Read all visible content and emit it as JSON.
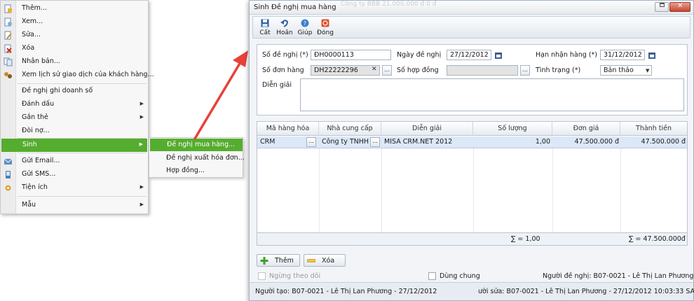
{
  "context_menu": {
    "items": [
      {
        "label": "Thêm...",
        "icon": "add-doc-icon"
      },
      {
        "label": "Xem...",
        "icon": "view-doc-icon"
      },
      {
        "label": "Sửa...",
        "icon": "edit-doc-icon"
      },
      {
        "label": "Xóa",
        "icon": "delete-doc-icon"
      },
      {
        "label": "Nhân bản...",
        "icon": "duplicate-icon"
      },
      {
        "label": "Xem lịch sử giao dịch của khách hàng...",
        "icon": "history-icon"
      },
      {
        "label": "Đề nghị ghi doanh số"
      },
      {
        "label": "Đánh dấu"
      },
      {
        "label": "Gắn thẻ"
      },
      {
        "label": "Đòi nợ..."
      },
      {
        "label": "Sinh"
      },
      {
        "label": "Gửi Email...",
        "icon": "email-icon"
      },
      {
        "label": "Gửi SMS...",
        "icon": "sms-icon"
      },
      {
        "label": "Tiện ích",
        "icon": "utility-icon"
      },
      {
        "label": "Mẫu"
      }
    ],
    "submenu": [
      {
        "label": "Đề nghị mua hàng..."
      },
      {
        "label": "Đề nghị xuất hóa đơn..."
      },
      {
        "label": "Hợp đồng..."
      }
    ],
    "accent": "#55ad2f"
  },
  "dialog": {
    "title": "Sinh Đề nghị mua hàng",
    "ghost_text": "Công ty BBB                              21.000.000 đ                    0 đ",
    "toolbar": {
      "save": "Cất",
      "undo": "Hoãn",
      "help": "Giúp",
      "close": "Đóng"
    },
    "form": {
      "so_de_nghi_label": "Số đề nghị (*)",
      "so_de_nghi_value": "ĐH0000113",
      "ngay_de_nghi_label": "Ngày đề nghị",
      "ngay_de_nghi_value": "27/12/2012",
      "han_nhan_hang_label": "Hạn nhận hàng (*)",
      "han_nhan_hang_value": "31/12/2012",
      "so_don_hang_label": "Số đơn hàng",
      "so_don_hang_value": "DH22222296",
      "so_hop_dong_label": "Số hợp đồng",
      "tinh_trang_label": "Tình trạng (*)",
      "tinh_trang_value": "Bản thảo",
      "dien_giai_label": "Diễn giải"
    },
    "grid": {
      "headers": [
        "Mã hàng hóa",
        "Nhà cung cấp",
        "Diễn giải",
        "Số lượng",
        "Đơn giá",
        "Thành tiền"
      ],
      "rows": [
        {
          "ma_hang": "CRM",
          "nha_cung_cap": "Công ty TNHH",
          "dien_giai": "MISA CRM.NET 2012",
          "so_luong": "1,00",
          "don_gia": "47.500.000 đ",
          "thanh_tien": "47.500.000 đ"
        }
      ],
      "sum_qty": "∑ =  1,00",
      "sum_total": "∑ =  47.500.000đ"
    },
    "buttons": {
      "add": "Thêm",
      "delete": "Xóa"
    },
    "footer": {
      "stop_tracking": "Ngừng theo dõi",
      "shared": "Dùng chung",
      "requester": "Người đề nghị:  B07-0021 - Lê Thị Lan Phương",
      "created_by": "Người tạo: B07-0021 - Lê Thị Lan Phương - 27/12/2012",
      "modified_by": "ười sửa: B07-0021 - Lê Thị Lan Phương - 27/12/2012 10:03:33 SA"
    }
  }
}
